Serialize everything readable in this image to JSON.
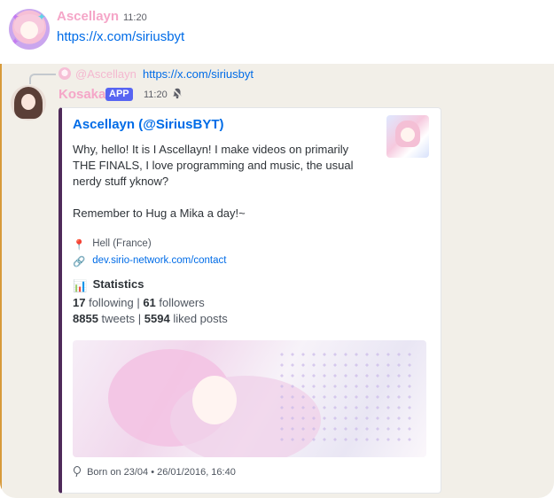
{
  "message1": {
    "author": "Ascellayn",
    "time": "11:20",
    "link": "https://x.com/siriusbyt"
  },
  "message2": {
    "reply": {
      "author": "@Ascellayn",
      "text": "https://x.com/siriusbyt"
    },
    "author": "Kosaka",
    "badge": "APP",
    "time": "11:20",
    "embed": {
      "title": "Ascellayn (@SiriusBYT)",
      "description": [
        "Why, hello! It is I Ascellayn! I make videos on primarily",
        "THE FINALS, I love programming and music, the usual",
        "nerdy stuff yknow?",
        "",
        "Remember to Hug a Mika a day!~"
      ],
      "location": "Hell (France)",
      "website": "dev.sirio-network.com/contact",
      "stats_title": "Statistics",
      "following": "17",
      "following_label": "following",
      "followers": "61",
      "followers_label": "followers",
      "tweets": "8855",
      "tweets_label": "tweets",
      "liked": "5594",
      "liked_label": "liked posts",
      "separator": "|",
      "footer": "Born on 23/04 • 26/01/2016, 16:40",
      "icons": {
        "location": "📍",
        "website": "🔗",
        "stats": "📊",
        "footer": "balloon-icon"
      }
    }
  },
  "colors": {
    "author_name": "#f5a6c8",
    "link": "#006ce7",
    "app_badge": "#5865f2",
    "highlight_bg": "#f2efe8",
    "highlight_bar": "#d89a3a",
    "embed_border": "#4f2a5a"
  }
}
